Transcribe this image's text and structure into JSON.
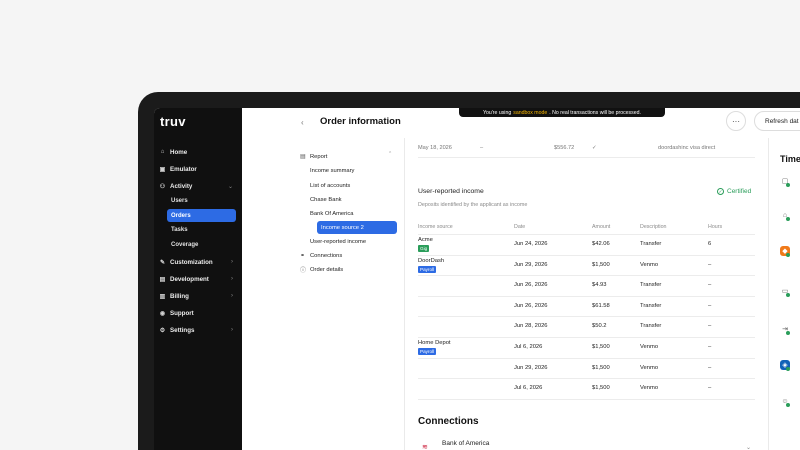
{
  "sidebar": {
    "logo": "truv",
    "items": [
      {
        "label": "Home",
        "icon": "home-icon",
        "glyph": "⌂"
      },
      {
        "label": "Emulator",
        "icon": "emulator-icon",
        "glyph": "▣"
      },
      {
        "label": "Activity",
        "icon": "activity-icon",
        "glyph": "⚇"
      },
      {
        "label": "Customization",
        "icon": "brush-icon",
        "glyph": "✎"
      },
      {
        "label": "Development",
        "icon": "code-icon",
        "glyph": "▤"
      },
      {
        "label": "Billing",
        "icon": "billing-icon",
        "glyph": "▥"
      },
      {
        "label": "Support",
        "icon": "support-icon",
        "glyph": "◉"
      },
      {
        "label": "Settings",
        "icon": "gear-icon",
        "glyph": "⚙"
      }
    ],
    "activity_sub": [
      "Users",
      "Orders",
      "Tasks",
      "Coverage"
    ]
  },
  "header": {
    "title": "Order information",
    "banner_prefix": "You're using",
    "banner_mode": "sandbox mode",
    "banner_suffix": ". No real transactions will be processed.",
    "more_label": "···",
    "refresh_label": "Refresh dat"
  },
  "report_tree": {
    "report": "Report",
    "items": [
      "Income summary",
      "List of accounts",
      "Chase Bank",
      "Bank Of America",
      "Income source 2",
      "User-reported income"
    ],
    "connections": "Connections",
    "order_details": "Order details"
  },
  "top_row": {
    "date": "May 18, 2026",
    "dash": "–",
    "amount": "$556.72",
    "check": "✓",
    "description": "doordashinc visa direct"
  },
  "user_reported": {
    "title": "User-reported income",
    "certified": "Certified",
    "description": "Deposits identified by the applicant as income",
    "columns": [
      "Income source",
      "Date",
      "Amount",
      "Description",
      "Hours"
    ],
    "rows": [
      {
        "source": "Acme",
        "badge": "Gig",
        "badge_color": "#2a9d5a",
        "date": "Jun 24, 2026",
        "amount": "$42.06",
        "desc": "Transfer",
        "hours": "6"
      },
      {
        "source": "DoorDash",
        "badge": "Payroll",
        "badge_color": "#2d6be4",
        "date": "Jun 29, 2026",
        "amount": "$1,500",
        "desc": "Venmo",
        "hours": "–"
      },
      {
        "source": "",
        "badge": "",
        "badge_color": "",
        "date": "Jun 26, 2026",
        "amount": "$4.93",
        "desc": "Transfer",
        "hours": "–"
      },
      {
        "source": "",
        "badge": "",
        "badge_color": "",
        "date": "Jun 26, 2026",
        "amount": "$61.58",
        "desc": "Transfer",
        "hours": "–"
      },
      {
        "source": "",
        "badge": "",
        "badge_color": "",
        "date": "Jun 28, 2026",
        "amount": "$50.2",
        "desc": "Transfer",
        "hours": "–"
      },
      {
        "source": "Home Depot",
        "badge": "Payroll",
        "badge_color": "#2d6be4",
        "date": "Jul 6, 2026",
        "amount": "$1,500",
        "desc": "Venmo",
        "hours": "–"
      },
      {
        "source": "",
        "badge": "",
        "badge_color": "",
        "date": "Jun 29, 2026",
        "amount": "$1,500",
        "desc": "Venmo",
        "hours": "–"
      },
      {
        "source": "",
        "badge": "",
        "badge_color": "",
        "date": "Jul 6, 2026",
        "amount": "$1,500",
        "desc": "Venmo",
        "hours": "–"
      }
    ]
  },
  "connections": {
    "title": "Connections",
    "bank": "Bank of America",
    "chevron": "⌄"
  },
  "timeline": {
    "title": "Time",
    "icons": [
      {
        "name": "document-icon",
        "glyph": "▢",
        "bg": "#ffffff",
        "color": "#666666"
      },
      {
        "name": "bank-building-icon",
        "glyph": "⌂",
        "bg": "#ffffff",
        "color": "#666666"
      },
      {
        "name": "employer-logo-icon",
        "glyph": "◆",
        "bg": "#f07a1a",
        "color": "#ffffff"
      },
      {
        "name": "briefcase-icon",
        "glyph": "▭",
        "bg": "#ffffff",
        "color": "#666666"
      },
      {
        "name": "link-icon",
        "glyph": "⇥",
        "bg": "#ffffff",
        "color": "#666666"
      },
      {
        "name": "chase-logo-icon",
        "glyph": "◈",
        "bg": "#1161b8",
        "color": "#ffffff"
      },
      {
        "name": "user-icon",
        "glyph": "☺",
        "bg": "#ffffff",
        "color": "#666666"
      }
    ]
  }
}
